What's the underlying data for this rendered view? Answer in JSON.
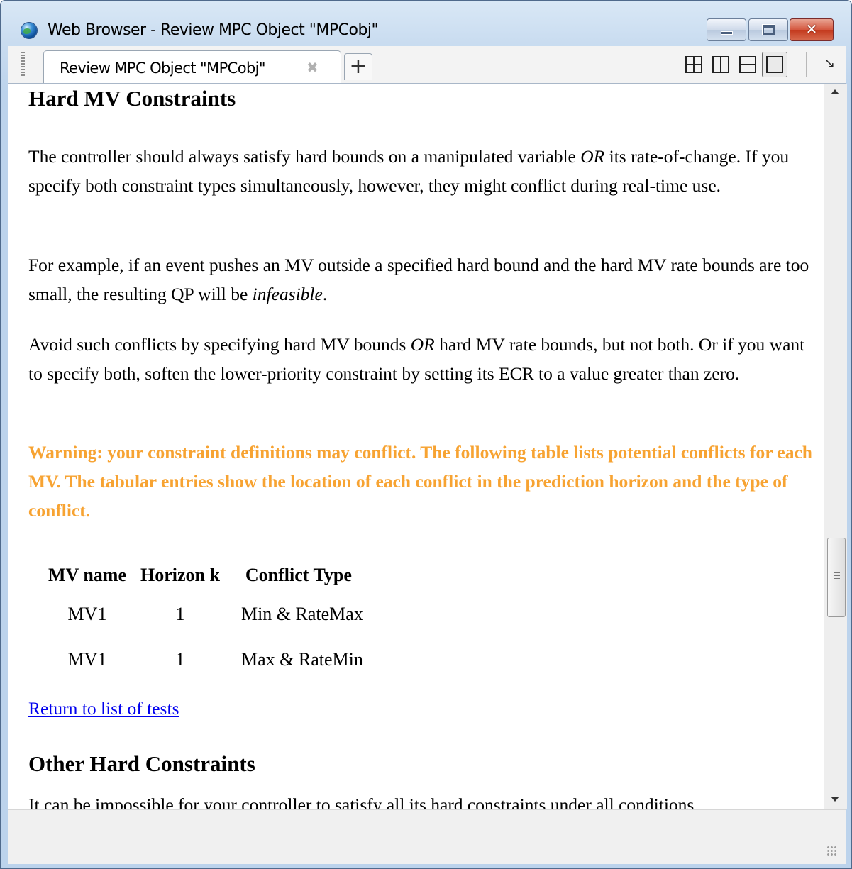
{
  "window": {
    "title": "Web Browser - Review MPC Object \"MPCobj\"",
    "minimize_icon": "minimize-icon",
    "maximize_icon": "maximize-icon",
    "close_glyph": "✕"
  },
  "tabs": {
    "active_label": "Review MPC Object \"MPCobj\"",
    "close_glyph": "✖",
    "add_glyph": "+",
    "layout_icons": [
      "grid-2x2-icon",
      "split-columns-icon",
      "split-rows-icon",
      "single-pane-icon"
    ],
    "undock_glyph": "↘"
  },
  "content": {
    "section1_heading": "Hard MV Constraints",
    "para1_a": "The controller should always satisfy hard bounds on a manipulated variable ",
    "para1_em": "OR",
    "para1_b": " its rate-of-change. If you specify both constraint types simultaneously, however, they might conflict during real-time use.",
    "para2_a": "For example, if an event pushes an MV outside a specified hard bound and the hard MV rate bounds are too small, the resulting QP will be ",
    "para2_em": "infeasible",
    "para2_b": ".",
    "para3_a": "Avoid such conflicts by specifying hard MV bounds ",
    "para3_em": "OR",
    "para3_b": " hard MV rate bounds, but not both. Or if you want to specify both, soften the lower-priority constraint by setting its ECR to a value greater than zero.",
    "warning": "Warning: your constraint definitions may conflict. The following table lists potential conflicts for each MV. The tabular entries show the location of each conflict in the prediction horizon and the type of conflict.",
    "table": {
      "headers": [
        "MV name",
        "Horizon k",
        "Conflict Type"
      ],
      "rows": [
        [
          "MV1",
          "1",
          "Min & RateMax"
        ],
        [
          "MV1",
          "1",
          "Max & RateMin"
        ]
      ]
    },
    "return_link": "Return to list of tests",
    "section2_heading": "Other Hard Constraints",
    "section2_text_partial": "It can be impossible for your controller to satisfy all its hard constraints under all conditions"
  },
  "colors": {
    "warning": "#f7a332",
    "link": "#0000ee",
    "frame": "#bcd3ec"
  }
}
